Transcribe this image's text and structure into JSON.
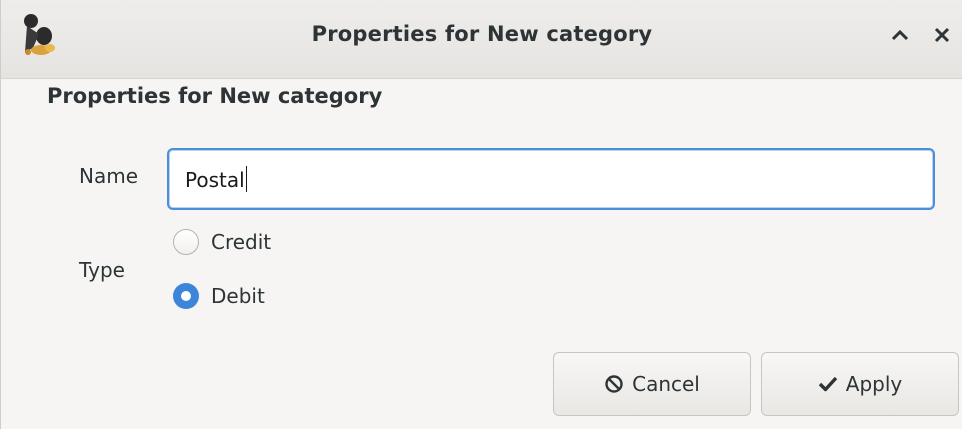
{
  "window": {
    "title": "Properties for New category",
    "icon": "grisbi-app-icon",
    "controls": [
      "maximize-icon",
      "close-icon"
    ]
  },
  "dialog": {
    "heading": "Properties for New category",
    "name_label": "Name",
    "name_value": "Postal",
    "type_label": "Type",
    "type_options": [
      {
        "label": "Credit",
        "selected": false
      },
      {
        "label": "Debit",
        "selected": true
      }
    ]
  },
  "buttons": {
    "cancel_label": "Cancel",
    "cancel_icon": "cancel-circle-icon",
    "apply_label": "Apply",
    "apply_icon": "checkmark-icon"
  },
  "colors": {
    "accent": "#3d85d8",
    "focus_border": "#4a90d9",
    "text": "#2e3436",
    "background": "#f6f5f4"
  }
}
